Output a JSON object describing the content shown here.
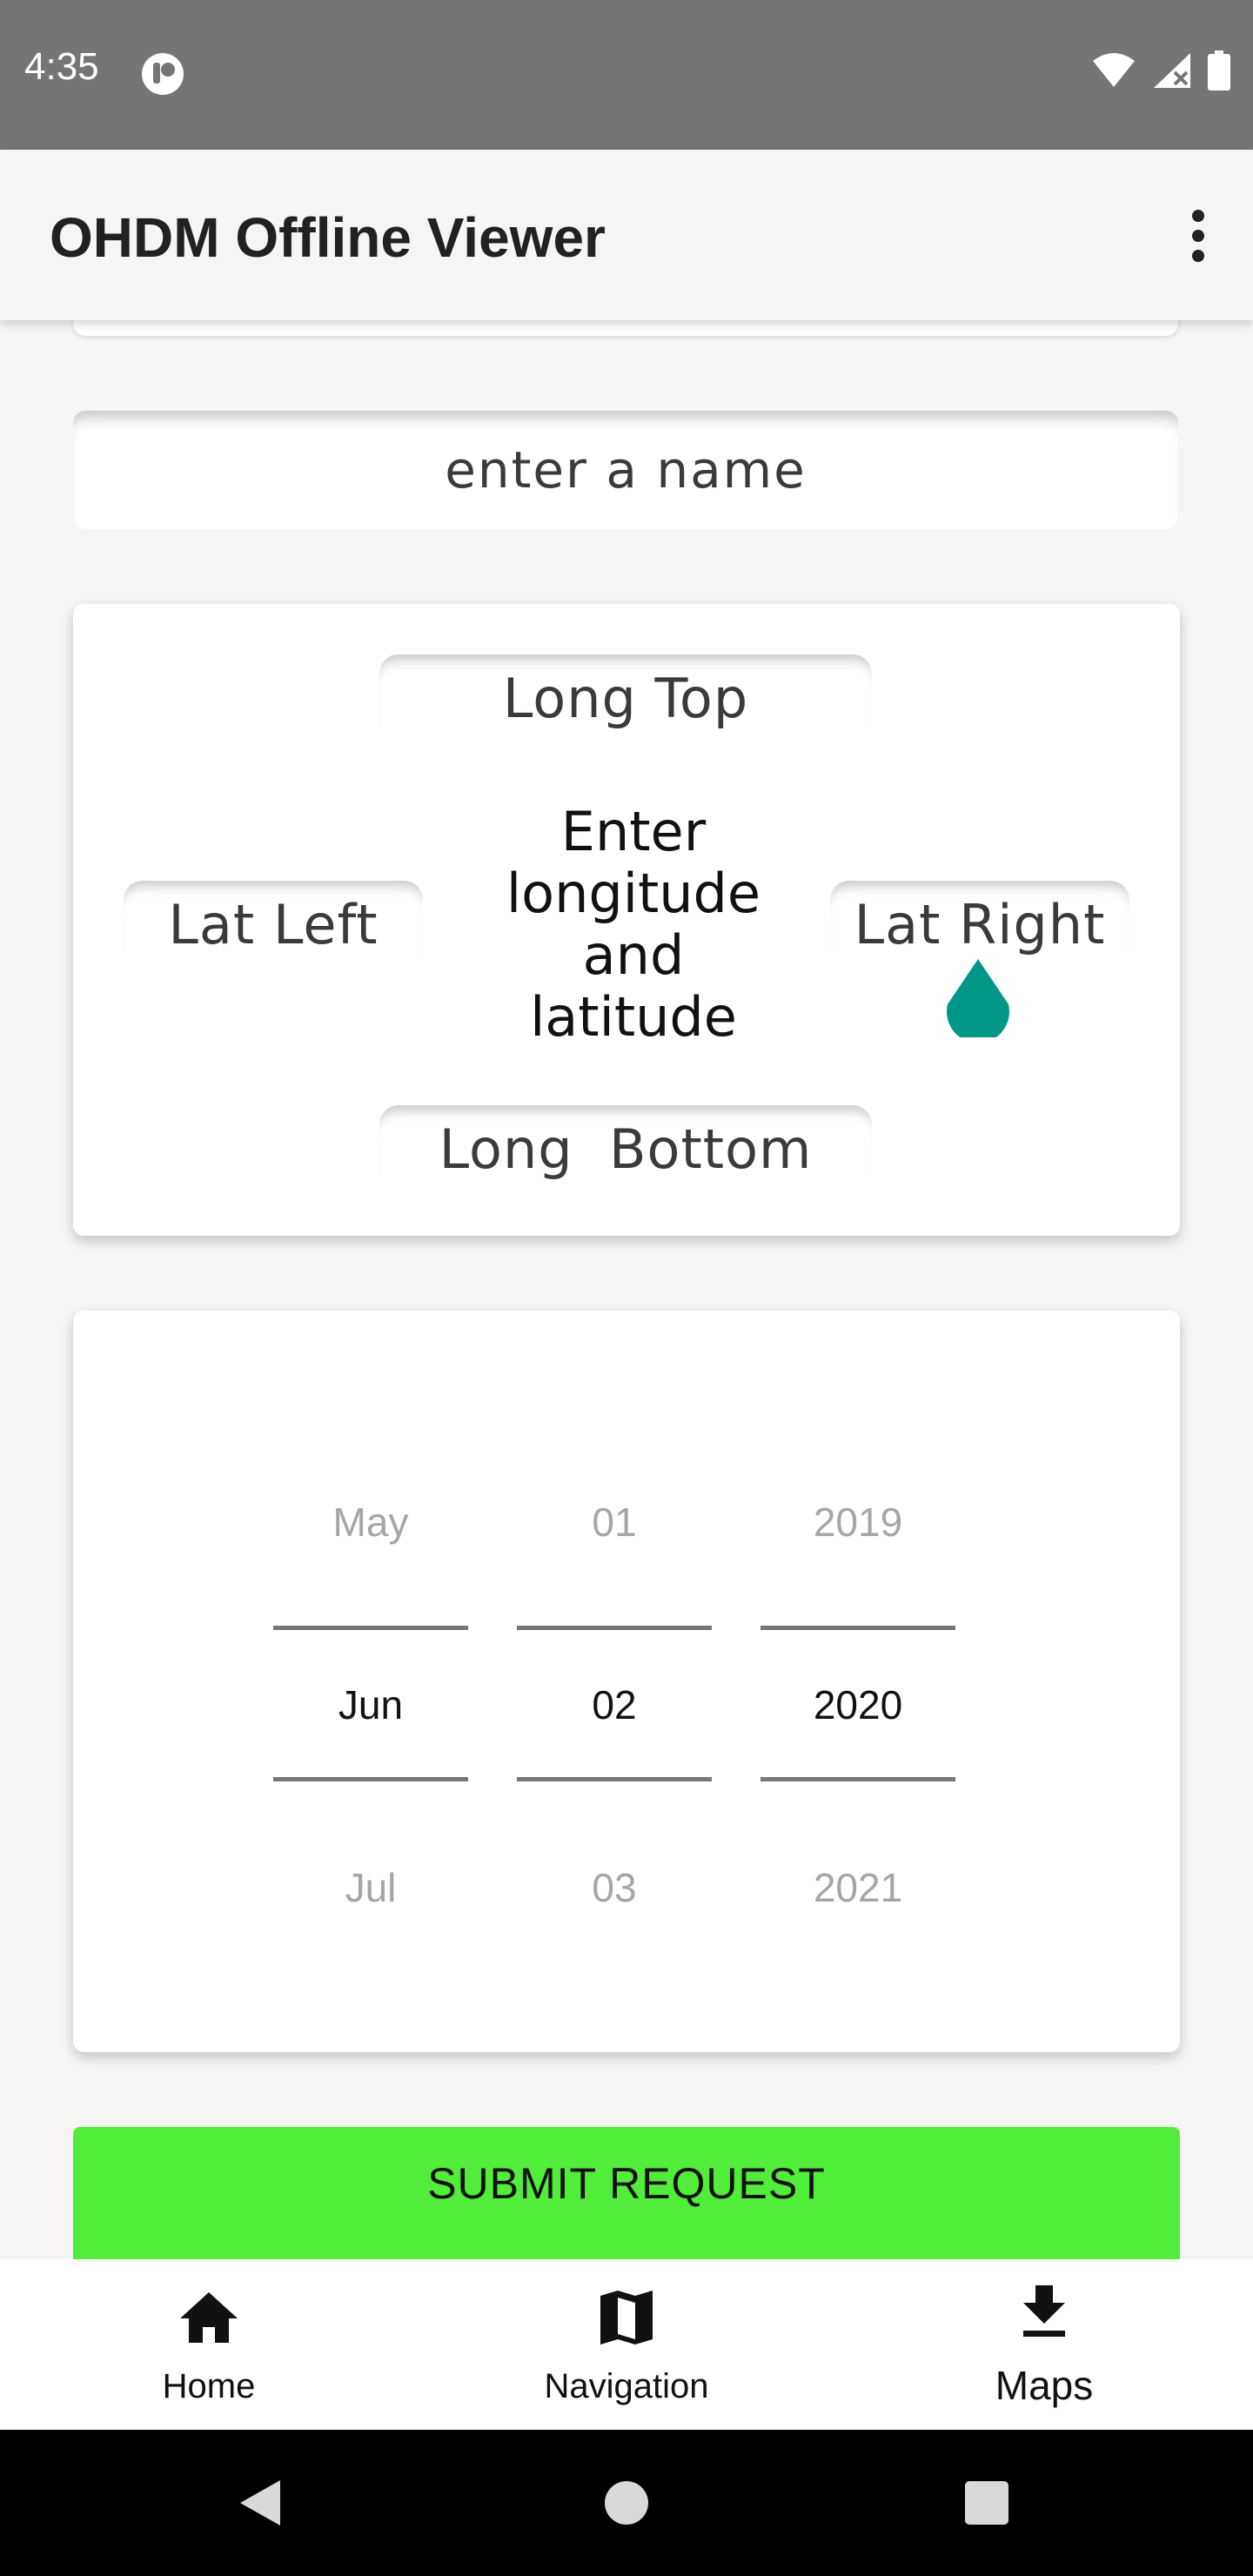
{
  "status_bar": {
    "time": "4:35",
    "icons": [
      "app-notification-icon",
      "wifi-icon",
      "signal-icon",
      "battery-icon"
    ]
  },
  "app_bar": {
    "title": "OHDM Offline Viewer",
    "menu_icon": "more-vert-icon"
  },
  "form": {
    "name_placeholder": "enter a name",
    "coordinates": {
      "long_top_placeholder": "Long Top",
      "lat_left_placeholder": "Lat Left",
      "lat_right_placeholder": "Lat Right",
      "long_bottom_placeholder": "Long  Bottom",
      "center_label": "Enter longitude and latitude"
    },
    "date_picker": {
      "month": {
        "prev": "May",
        "selected": "Jun",
        "next": "Jul"
      },
      "day": {
        "prev": "01",
        "selected": "02",
        "next": "03"
      },
      "year": {
        "prev": "2019",
        "selected": "2020",
        "next": "2021"
      }
    },
    "submit_label": "SUBMIT REQUEST"
  },
  "bottom_nav": {
    "items": [
      {
        "label": "Home",
        "icon": "home-icon"
      },
      {
        "label": "Navigation",
        "icon": "map-icon"
      },
      {
        "label": "Maps",
        "icon": "download-icon",
        "active": true
      }
    ]
  },
  "colors": {
    "status_bar": "#757575",
    "submit_button": "#52EC3A",
    "accent_drop": "#009688"
  }
}
